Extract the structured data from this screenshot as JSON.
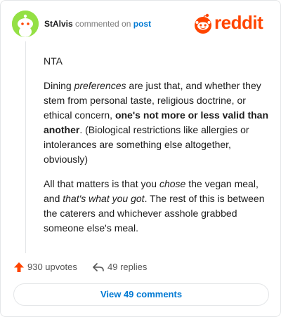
{
  "header": {
    "username": "StAlvis",
    "verb": "commented on",
    "post_link": "post",
    "logo_text": "reddit"
  },
  "comment": {
    "p1": "NTA",
    "p2_a": "Dining ",
    "p2_b": "preferences",
    "p2_c": " are just that, and whether they stem from personal taste, religious doctrine, or ethical concern, ",
    "p2_d": "one's not more or less valid than another",
    "p2_e": ". (Biological restrictions like allergies or intolerances are something else altogether, obviously)",
    "p3_a": "All that matters is that you ",
    "p3_b": "chose",
    "p3_c": " the vegan meal, and ",
    "p3_d": "that's what you got",
    "p3_e": ". The rest of this is between the caterers and whichever asshole grabbed someone else's meal."
  },
  "actions": {
    "upvotes": "930 upvotes",
    "replies": "49 replies"
  },
  "footer": {
    "view_comments": "View 49 comments"
  },
  "colors": {
    "reddit_orange": "#ff4500",
    "avatar_green": "#94e044",
    "link_blue": "#0079d3"
  }
}
